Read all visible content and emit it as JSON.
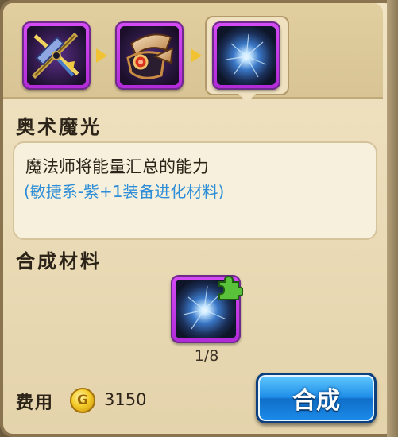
{
  "evolution_chain": [
    {
      "name": "crossbow-item",
      "frame_color": "#c237e8"
    },
    {
      "name": "armguard-item",
      "frame_color": "#c237e8"
    },
    {
      "name": "arcane-orb-item",
      "frame_color": "#c237e8",
      "selected": true
    }
  ],
  "item": {
    "name": "奥术魔光",
    "description": "魔法师将能量汇总的能力",
    "detail": "(敏捷系-紫+1装备进化材料)"
  },
  "materials": {
    "label": "合成材料",
    "items": [
      {
        "icon": "arcane-orb-fragment-icon",
        "count": "1/8"
      }
    ]
  },
  "cost": {
    "label": "费用",
    "currency_icon": "gold-coin-icon",
    "currency_symbol": "G",
    "value": "3150"
  },
  "action": {
    "craft_label": "合成"
  },
  "colors": {
    "accent_blue": "#2d8ed7",
    "rarity_purple": "#c237e8",
    "button_blue": "#1f8ee8",
    "gold": "#f5cd2b"
  }
}
